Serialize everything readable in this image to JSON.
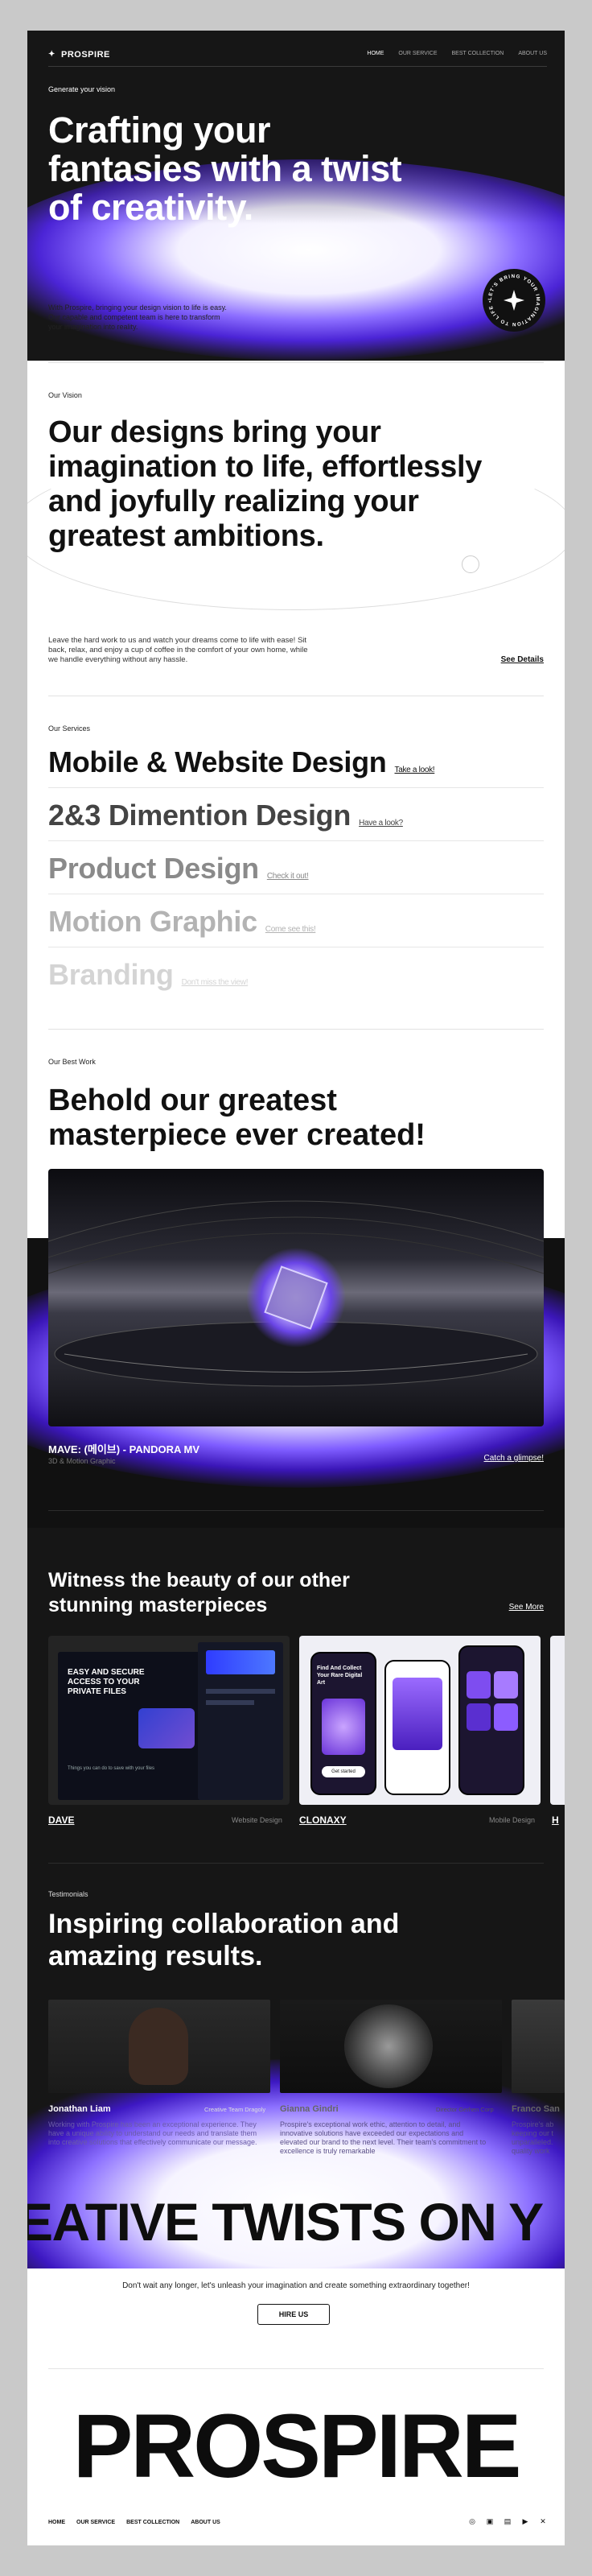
{
  "brand": "PROSPIRE",
  "nav": {
    "items": [
      "HOME",
      "OUR SERVICE",
      "BEST COLLECTION",
      "ABOUT US"
    ]
  },
  "hero": {
    "eyebrow": "Generate your vision",
    "title": "Crafting your fantasies with a twist of creativity.",
    "description": "With Prospire, bringing your design vision to life is easy. Our capable and competent team is here to transform your imagination into reality.",
    "badge_text": "LET'S BRING YOUR IMAGINATION TO LIFE"
  },
  "vision": {
    "label": "Our Vision",
    "title": "Our designs bring your imagination to life, effortlessly and joyfully realizing your greatest ambitions.",
    "description": "Leave the hard work to us and watch your dreams come to life with ease! Sit back, relax, and enjoy a cup of coffee in the comfort of your own home, while we handle everything without any hassle.",
    "link": "See Details"
  },
  "services": {
    "label": "Our Services",
    "items": [
      {
        "title": "Mobile & Website Design",
        "link": "Take a look!",
        "color": "#111111"
      },
      {
        "title": "2&3 Dimention Design",
        "link": "Have a look?",
        "color": "#444444"
      },
      {
        "title": "Product Design",
        "link": "Check it out!",
        "color": "#8a8a8a"
      },
      {
        "title": "Motion Graphic",
        "link": "Come see this!",
        "color": "#b3b3b3"
      },
      {
        "title": "Branding",
        "link": "Don't miss the view!",
        "color": "#d4d4d4"
      }
    ]
  },
  "best_work": {
    "label": "Our Best Work",
    "title": "Behold our greatest masterpiece ever created!",
    "featured": {
      "title": "MAVE: (메이브) - PANDORA MV",
      "category": "3D & Motion Graphic",
      "link": "Catch a glimpse!"
    }
  },
  "witness": {
    "title": "Witness the beauty of our other stunning masterpieces",
    "link": "See More",
    "cards": [
      {
        "name": "DAVE",
        "category": "Website Design",
        "headline": "EASY AND SECURE ACCESS TO YOUR PRIVATE FILES",
        "sub": "Things you can do to save with your files"
      },
      {
        "name": "CLONAXY",
        "category": "Mobile Design",
        "headline": "Find And Collect Your Rare Digital Art",
        "sub": "Get started"
      }
    ]
  },
  "testimonials": {
    "label": "Testimonials",
    "title": "Inspiring collaboration and amazing results.",
    "items": [
      {
        "name": "Jonathan Liam",
        "role": "Creative Team Dragoly",
        "quote": "Working with Prospire has been an exceptional experience. They have a unique ability to understand our needs and translate them into creative solutions that effectively communicate our message."
      },
      {
        "name": "Gianna Gindri",
        "role": "Director Gerhen Corp",
        "quote": "Prospire's exceptional work ethic, attention to detail, and innovative solutions have exceeded our expectations and elevated our brand to the next level. Their team's commitment to excellence is truly remarkable"
      },
      {
        "name": "Franco San",
        "role": "",
        "quote": "Prospire's ab keeping our t unparalleled. quality work"
      }
    ]
  },
  "cta": {
    "marquee": "EATIVE TWISTS ON Y",
    "text": "Don't wait any longer, let's unleash your imagination and create something extraordinary together!",
    "button": "HIRE US"
  },
  "footer": {
    "brand": "PROSPIRE",
    "nav": [
      "HOME",
      "OUR SERVICE",
      "BEST COLLECTION",
      "ABOUT US"
    ],
    "socials": [
      "instagram-icon",
      "facebook-icon",
      "linkedin-icon",
      "youtube-icon",
      "twitter-icon"
    ]
  },
  "colors": {
    "accent": "#5a2ff0",
    "dark": "#161616",
    "light": "#ffffff"
  }
}
